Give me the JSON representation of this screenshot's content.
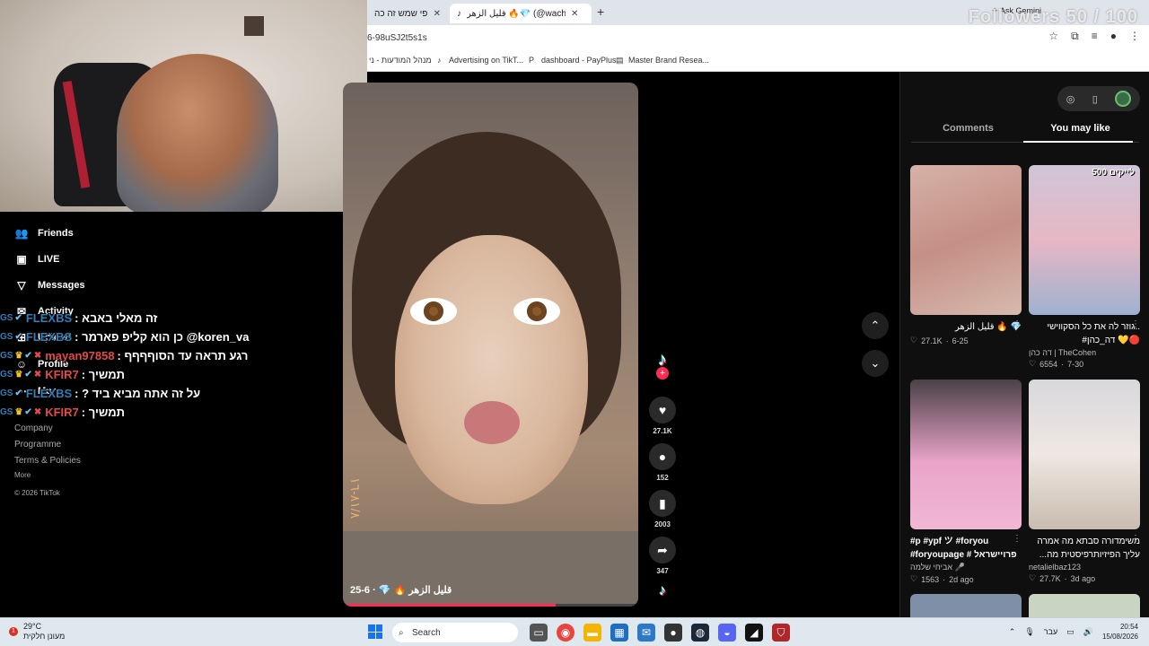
{
  "browser": {
    "tab_inactive_title": "משקפי שמש זה כה",
    "tab_active_title": "قليل الزهر 🔥💎 (@wache)",
    "url": "6-98uSJ2t5s1s",
    "ask_gemini": "Ask Gemini",
    "bookmarks": [
      "מנהל המודעות - ני",
      "Advertising on TikT...",
      "dashboard - PayPlus",
      "Master Brand Resea..."
    ]
  },
  "stream_overlay": {
    "followers_goal": "Followers 50 / 100",
    "chat": [
      {
        "user": "FLEXBS",
        "message": "זה מאלי באבא"
      },
      {
        "user": "FLEXBS",
        "message": "כן הוא קליפ פארמר @koren_va"
      },
      {
        "user": "mayan97858",
        "message": "רגע תראה עד הסוףףףף"
      },
      {
        "user": "KFIR7",
        "message": "תמשיך"
      },
      {
        "user": "FLEXBS",
        "message": "? על זה אתה מביא ביד"
      },
      {
        "user": "KFIR7",
        "message": "תמשיך"
      }
    ]
  },
  "sidebar": {
    "items": [
      {
        "label": "Friends",
        "icon": "friends-icon"
      },
      {
        "label": "LIVE",
        "icon": "live-icon"
      },
      {
        "label": "Messages",
        "icon": "messages-icon"
      },
      {
        "label": "Activity",
        "icon": "activity-icon",
        "badge": "9"
      },
      {
        "label": "Upload",
        "icon": "upload-icon"
      },
      {
        "label": "Profile",
        "icon": "profile-icon"
      },
      {
        "label": "More",
        "icon": "more-icon"
      }
    ],
    "footer_links": [
      "Company",
      "Programme",
      "Terms & Policies"
    ],
    "footer_more": "More",
    "copyright": "© 2026 TikTok"
  },
  "video": {
    "caption": "قليل الزهر 🔥 💎 · 6-25",
    "side_text": "٨١/٨-١٦",
    "progress": 0.72
  },
  "actions": {
    "likes": "27.1K",
    "comments": "152",
    "saves": "2003",
    "shares": "347"
  },
  "right_panel": {
    "tab_comments": "Comments",
    "tab_you_may_like": "You may like",
    "cards": [
      {
        "badge": "",
        "title": "قليل الزهر 🔥 💎",
        "meta_likes": "27.1K",
        "meta_date": "6-25",
        "author": ""
      },
      {
        "badge": "500 לייקים",
        "title": "גוזר לה את כל הסקווישי..",
        "subtitle": "#דה_כהן 💛🔴",
        "author": "דה כהן | TheCohen",
        "meta_likes": "6554",
        "meta_date": "7-30"
      },
      {
        "badge": "",
        "title": "#p #ypf ツ #foryou",
        "subtitle": "#foryoupage # פרויישראל",
        "author": "אביחי שלמה 🎤",
        "meta_likes": "1563",
        "meta_date": "2d ago"
      },
      {
        "badge": "",
        "title": "משימדורה סבתא מה אמרה",
        "subtitle": "...עליך הפיזיותרפיסטית מה",
        "author": "netalielbaz123",
        "meta_likes": "27.7K",
        "meta_date": "3d ago"
      }
    ]
  },
  "taskbar": {
    "temperature": "29°C",
    "weather_desc": "מעונן חלקית",
    "weather_badge": "1",
    "search": "Search",
    "language": "עבר",
    "time": "20:54",
    "date": "15/08/2026"
  },
  "colors": {
    "accent": "#fe2c55",
    "cyan": "#25f4ee"
  }
}
